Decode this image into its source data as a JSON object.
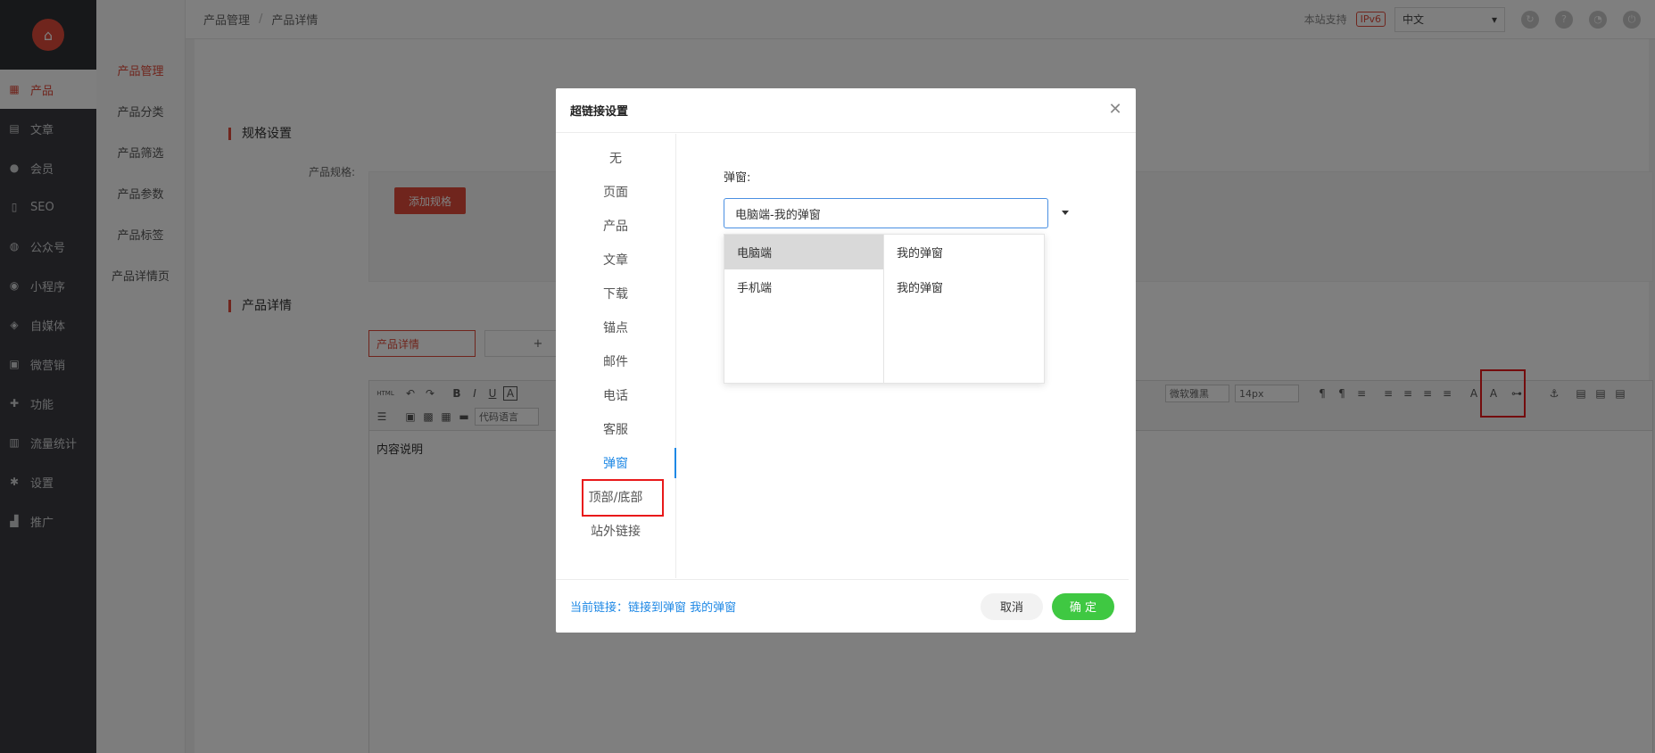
{
  "nav": {
    "items": [
      {
        "label": "产品",
        "icon": "grid-icon",
        "active": true
      },
      {
        "label": "文章",
        "icon": "document-icon"
      },
      {
        "label": "会员",
        "icon": "user-icon"
      },
      {
        "label": "SEO",
        "icon": "file-icon"
      },
      {
        "label": "公众号",
        "icon": "wechat-icon"
      },
      {
        "label": "小程序",
        "icon": "mini-program-icon"
      },
      {
        "label": "自媒体",
        "icon": "media-icon"
      },
      {
        "label": "微营销",
        "icon": "gift-icon"
      },
      {
        "label": "功能",
        "icon": "puzzle-icon"
      },
      {
        "label": "流量统计",
        "icon": "bar-chart-icon"
      },
      {
        "label": "设置",
        "icon": "gear-icon"
      },
      {
        "label": "推广",
        "icon": "promotion-icon"
      }
    ]
  },
  "subnav": {
    "items": [
      {
        "label": "产品管理",
        "active": true
      },
      {
        "label": "产品分类"
      },
      {
        "label": "产品筛选"
      },
      {
        "label": "产品参数"
      },
      {
        "label": "产品标签"
      },
      {
        "label": "产品详情页"
      }
    ]
  },
  "topbar": {
    "crumb1": "产品管理",
    "crumb_sep": "/",
    "crumb2": "产品详情",
    "support": "本站支持",
    "ipv6": "IPv6",
    "language": "中文"
  },
  "main": {
    "spec_title": "规格设置",
    "spec_label": "产品规格:",
    "add_spec": "添加规格",
    "detail_title": "产品详情",
    "detail_tab": "产品详情",
    "plus": "+",
    "editor": {
      "html_btn": "HTML",
      "code_lang": "代码语言",
      "font": "微软雅黑",
      "size": "14px",
      "body": "内容说明"
    }
  },
  "modal": {
    "title": "超链接设置",
    "categories": [
      {
        "label": "无"
      },
      {
        "label": "页面"
      },
      {
        "label": "产品"
      },
      {
        "label": "文章"
      },
      {
        "label": "下载"
      },
      {
        "label": "锚点"
      },
      {
        "label": "邮件"
      },
      {
        "label": "电话"
      },
      {
        "label": "客服"
      },
      {
        "label": "弹窗",
        "active": true
      },
      {
        "label": "顶部/底部"
      },
      {
        "label": "站外链接"
      }
    ],
    "popup_label": "弹窗:",
    "popup_value": "电脑端-我的弹窗",
    "cascader": {
      "col1": [
        "电脑端",
        "手机端"
      ],
      "col2": [
        "我的弹窗",
        "我的弹窗"
      ]
    },
    "current_link": "当前链接：链接到弹窗 我的弹窗",
    "cancel": "取消",
    "ok": "确 定"
  },
  "colors": {
    "accent": "#e04b3a",
    "link_blue": "#1e88e5",
    "ok_green": "#3fc842",
    "highlight_red": "#e8191a"
  }
}
